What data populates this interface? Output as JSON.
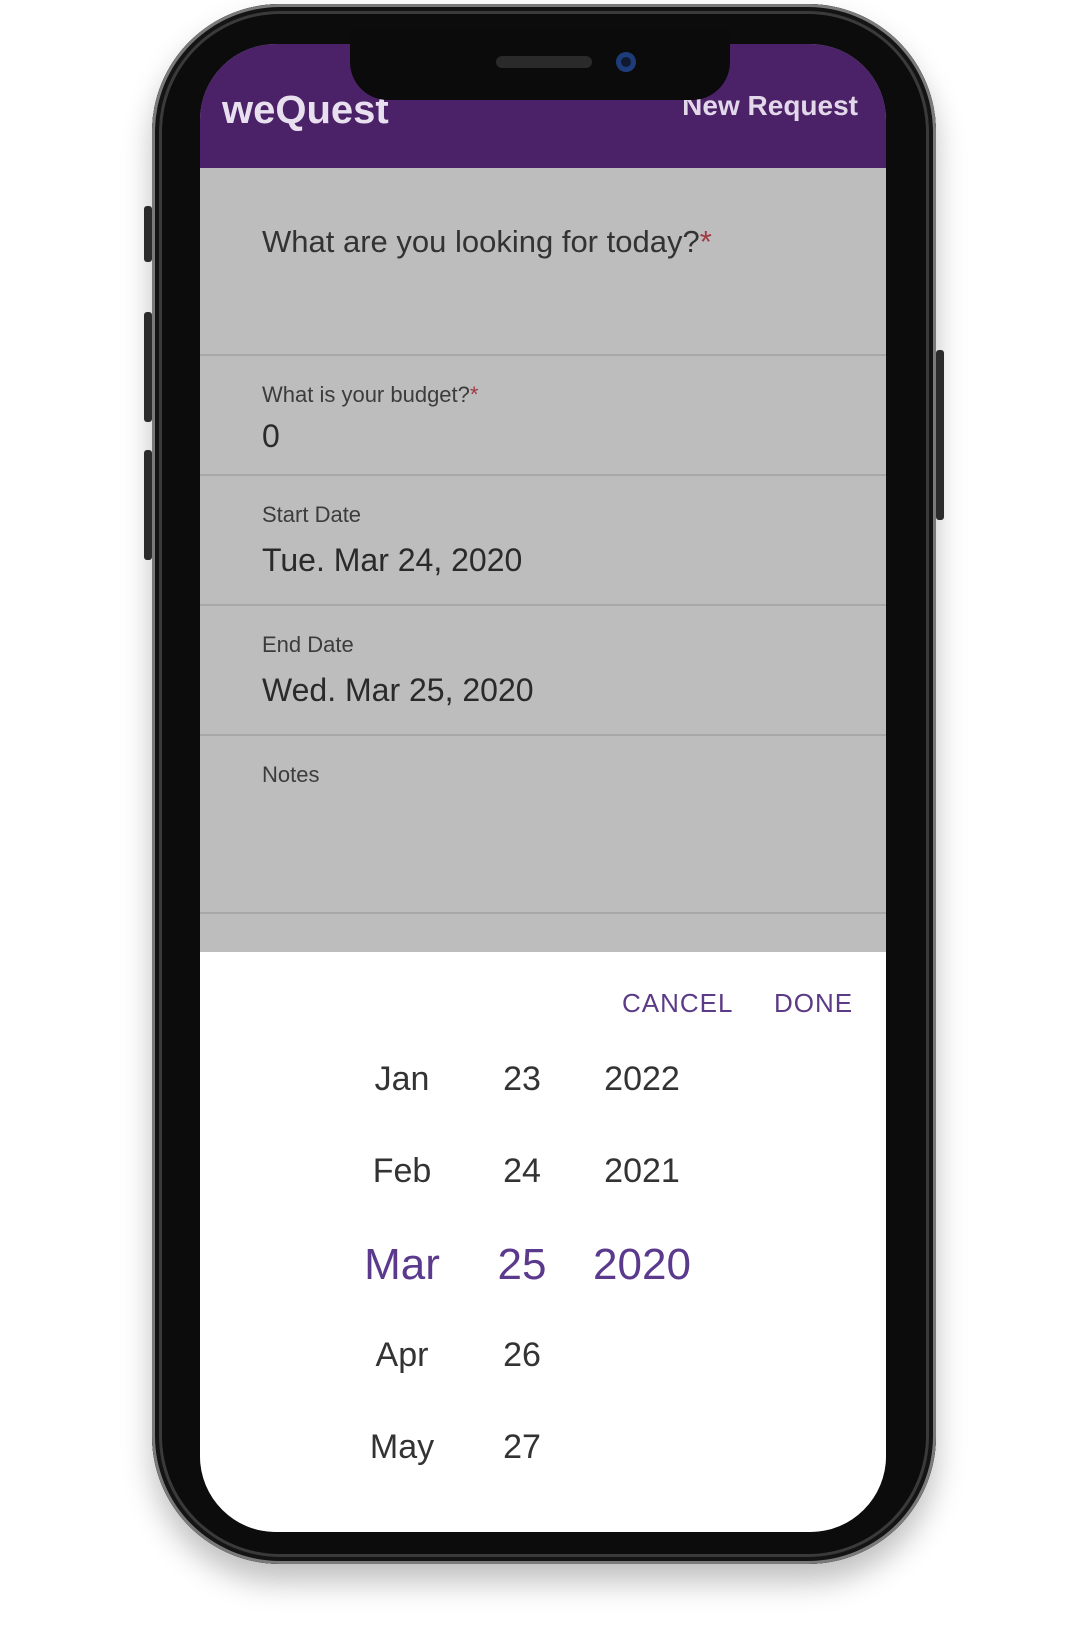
{
  "header": {
    "brand": "weQuest",
    "action": "New Request"
  },
  "form": {
    "question": "What are you looking for today?",
    "required_mark": "*",
    "budget_label": "What is your budget?",
    "budget_value": "0",
    "start_label": "Start Date",
    "start_value": "Tue. Mar 24, 2020",
    "end_label": "End Date",
    "end_value": "Wed. Mar 25, 2020",
    "notes_label": "Notes"
  },
  "picker": {
    "cancel": "CANCEL",
    "done": "DONE",
    "months": [
      "Jan",
      "Feb",
      "Mar",
      "Apr",
      "May"
    ],
    "days": [
      "23",
      "24",
      "25",
      "26",
      "27"
    ],
    "years": [
      "2022",
      "2021",
      "2020"
    ],
    "selected": {
      "month": "Mar",
      "day": "25",
      "year": "2020"
    }
  },
  "colors": {
    "header_bg": "#4b2168",
    "accent": "#5b3a8e",
    "required": "#a03a44"
  }
}
